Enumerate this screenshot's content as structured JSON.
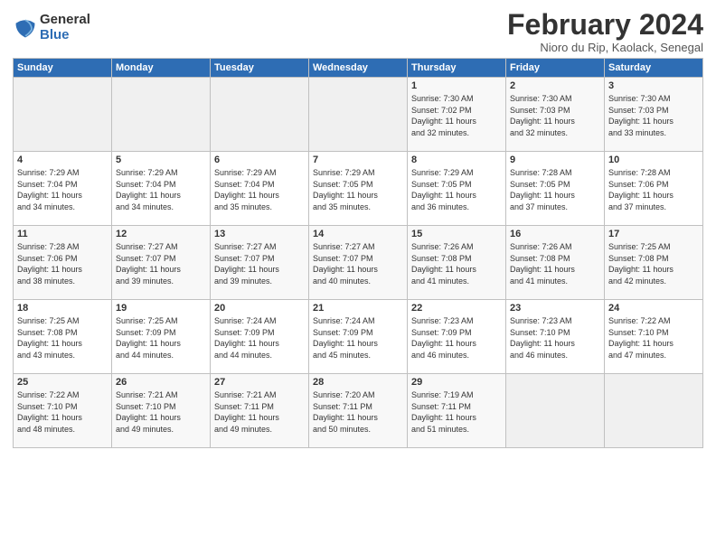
{
  "logo": {
    "general": "General",
    "blue": "Blue"
  },
  "title": "February 2024",
  "subtitle": "Nioro du Rip, Kaolack, Senegal",
  "days_header": [
    "Sunday",
    "Monday",
    "Tuesday",
    "Wednesday",
    "Thursday",
    "Friday",
    "Saturday"
  ],
  "weeks": [
    [
      {
        "num": "",
        "info": ""
      },
      {
        "num": "",
        "info": ""
      },
      {
        "num": "",
        "info": ""
      },
      {
        "num": "",
        "info": ""
      },
      {
        "num": "1",
        "info": "Sunrise: 7:30 AM\nSunset: 7:02 PM\nDaylight: 11 hours\nand 32 minutes."
      },
      {
        "num": "2",
        "info": "Sunrise: 7:30 AM\nSunset: 7:03 PM\nDaylight: 11 hours\nand 32 minutes."
      },
      {
        "num": "3",
        "info": "Sunrise: 7:30 AM\nSunset: 7:03 PM\nDaylight: 11 hours\nand 33 minutes."
      }
    ],
    [
      {
        "num": "4",
        "info": "Sunrise: 7:29 AM\nSunset: 7:04 PM\nDaylight: 11 hours\nand 34 minutes."
      },
      {
        "num": "5",
        "info": "Sunrise: 7:29 AM\nSunset: 7:04 PM\nDaylight: 11 hours\nand 34 minutes."
      },
      {
        "num": "6",
        "info": "Sunrise: 7:29 AM\nSunset: 7:04 PM\nDaylight: 11 hours\nand 35 minutes."
      },
      {
        "num": "7",
        "info": "Sunrise: 7:29 AM\nSunset: 7:05 PM\nDaylight: 11 hours\nand 35 minutes."
      },
      {
        "num": "8",
        "info": "Sunrise: 7:29 AM\nSunset: 7:05 PM\nDaylight: 11 hours\nand 36 minutes."
      },
      {
        "num": "9",
        "info": "Sunrise: 7:28 AM\nSunset: 7:05 PM\nDaylight: 11 hours\nand 37 minutes."
      },
      {
        "num": "10",
        "info": "Sunrise: 7:28 AM\nSunset: 7:06 PM\nDaylight: 11 hours\nand 37 minutes."
      }
    ],
    [
      {
        "num": "11",
        "info": "Sunrise: 7:28 AM\nSunset: 7:06 PM\nDaylight: 11 hours\nand 38 minutes."
      },
      {
        "num": "12",
        "info": "Sunrise: 7:27 AM\nSunset: 7:07 PM\nDaylight: 11 hours\nand 39 minutes."
      },
      {
        "num": "13",
        "info": "Sunrise: 7:27 AM\nSunset: 7:07 PM\nDaylight: 11 hours\nand 39 minutes."
      },
      {
        "num": "14",
        "info": "Sunrise: 7:27 AM\nSunset: 7:07 PM\nDaylight: 11 hours\nand 40 minutes."
      },
      {
        "num": "15",
        "info": "Sunrise: 7:26 AM\nSunset: 7:08 PM\nDaylight: 11 hours\nand 41 minutes."
      },
      {
        "num": "16",
        "info": "Sunrise: 7:26 AM\nSunset: 7:08 PM\nDaylight: 11 hours\nand 41 minutes."
      },
      {
        "num": "17",
        "info": "Sunrise: 7:25 AM\nSunset: 7:08 PM\nDaylight: 11 hours\nand 42 minutes."
      }
    ],
    [
      {
        "num": "18",
        "info": "Sunrise: 7:25 AM\nSunset: 7:08 PM\nDaylight: 11 hours\nand 43 minutes."
      },
      {
        "num": "19",
        "info": "Sunrise: 7:25 AM\nSunset: 7:09 PM\nDaylight: 11 hours\nand 44 minutes."
      },
      {
        "num": "20",
        "info": "Sunrise: 7:24 AM\nSunset: 7:09 PM\nDaylight: 11 hours\nand 44 minutes."
      },
      {
        "num": "21",
        "info": "Sunrise: 7:24 AM\nSunset: 7:09 PM\nDaylight: 11 hours\nand 45 minutes."
      },
      {
        "num": "22",
        "info": "Sunrise: 7:23 AM\nSunset: 7:09 PM\nDaylight: 11 hours\nand 46 minutes."
      },
      {
        "num": "23",
        "info": "Sunrise: 7:23 AM\nSunset: 7:10 PM\nDaylight: 11 hours\nand 46 minutes."
      },
      {
        "num": "24",
        "info": "Sunrise: 7:22 AM\nSunset: 7:10 PM\nDaylight: 11 hours\nand 47 minutes."
      }
    ],
    [
      {
        "num": "25",
        "info": "Sunrise: 7:22 AM\nSunset: 7:10 PM\nDaylight: 11 hours\nand 48 minutes."
      },
      {
        "num": "26",
        "info": "Sunrise: 7:21 AM\nSunset: 7:10 PM\nDaylight: 11 hours\nand 49 minutes."
      },
      {
        "num": "27",
        "info": "Sunrise: 7:21 AM\nSunset: 7:11 PM\nDaylight: 11 hours\nand 49 minutes."
      },
      {
        "num": "28",
        "info": "Sunrise: 7:20 AM\nSunset: 7:11 PM\nDaylight: 11 hours\nand 50 minutes."
      },
      {
        "num": "29",
        "info": "Sunrise: 7:19 AM\nSunset: 7:11 PM\nDaylight: 11 hours\nand 51 minutes."
      },
      {
        "num": "",
        "info": ""
      },
      {
        "num": "",
        "info": ""
      }
    ]
  ]
}
